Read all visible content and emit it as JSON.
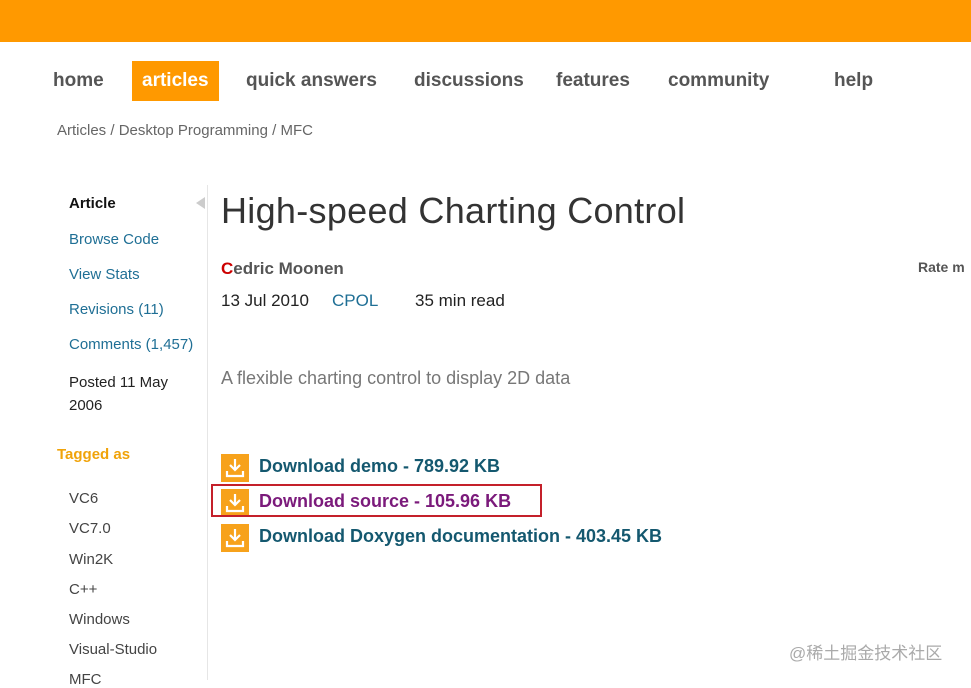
{
  "nav": {
    "items": [
      {
        "label": "home"
      },
      {
        "label": "articles",
        "active": true
      },
      {
        "label": "quick answers"
      },
      {
        "label": "discussions"
      },
      {
        "label": "features"
      },
      {
        "label": "community"
      },
      {
        "label": "help"
      }
    ]
  },
  "breadcrumb": {
    "items": [
      "Articles",
      "Desktop Programming",
      "MFC"
    ],
    "separator": "/"
  },
  "sidebar": {
    "article_label": "Article",
    "links": [
      "Browse Code",
      "View Stats",
      "Revisions (11)",
      "Comments (1,457)"
    ],
    "posted": "Posted 11 May 2006",
    "tagged_label": "Tagged as",
    "tags": [
      "VC6",
      "VC7.0",
      "Win2K",
      "C++",
      "Windows",
      "Visual-Studio",
      "MFC"
    ]
  },
  "article": {
    "title": "High-speed Charting Control",
    "author_first_letter": "C",
    "author_rest": "edric Moonen",
    "date": "13 Jul 2010",
    "license": "CPOL",
    "read_time": "35 min read",
    "rate_label": "Rate m",
    "summary": "A flexible charting control to display 2D data"
  },
  "downloads": [
    {
      "label": "Download demo - 789.92 KB",
      "icon": "download-icon"
    },
    {
      "label": "Download source - 105.96 KB",
      "icon": "download-icon",
      "visited": true
    },
    {
      "label": "Download Doxygen documentation - 403.45 KB",
      "icon": "download-icon"
    }
  ],
  "watermark": "@稀土掘金技术社区",
  "colors": {
    "brand": "#ff9900",
    "link": "#1f6f95",
    "download_link": "#14586f",
    "visited": "#7b1a7b",
    "highlight": "#c4202a"
  }
}
